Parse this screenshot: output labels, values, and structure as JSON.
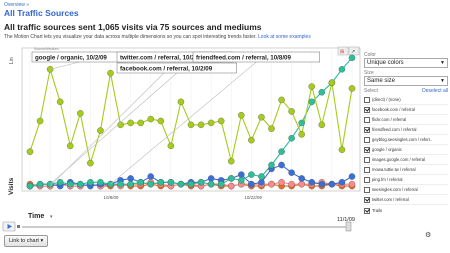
{
  "breadcrumb": "Overview »",
  "page_title": "All Traffic Sources",
  "headline": "All traffic sources sent 1,065 visits via 75 sources and mediums",
  "description": "The Motion Chart lets you visualize your data across multiple dimensions so you can spot interesting trends faster.",
  "description_link": "Look at some examples",
  "chart": {
    "source_label": "Source/Medium",
    "y_axis_label": "Visits",
    "y_scale": "Lin",
    "x_axis_label": "Time",
    "x_scale": "Lin",
    "date_shown": "11/1/09",
    "tooltips": [
      "google / organic, 10/2/09",
      "twitter.com / referral, 10/2/09",
      "friendfeed.com / referral, 10/8/09",
      "facebook.com / referral, 10/2/09"
    ],
    "x_tick_labels": [
      "10/8/09",
      "10/22/09"
    ]
  },
  "sidebar": {
    "color_label": "Color",
    "color_value": "Unique colors",
    "size_label": "Size",
    "size_value": "Same size",
    "select_label": "Select",
    "deselect_all": "Deselect all",
    "items": [
      {
        "label": "(direct) / (none)",
        "checked": false
      },
      {
        "label": "facebook.com / referral",
        "checked": true
      },
      {
        "label": "flickr.com / referral",
        "checked": false
      },
      {
        "label": "friendfeed.com / referral",
        "checked": true
      },
      {
        "label": "geyblog.seesingles.com / referr..",
        "checked": false
      },
      {
        "label": "google / organic",
        "checked": true
      },
      {
        "label": "images.google.com / referral",
        "checked": false
      },
      {
        "label": "mowa.tuttie.tw / referral",
        "checked": false
      },
      {
        "label": "ping.fm / referral",
        "checked": false
      },
      {
        "label": "seesingles.com / referral",
        "checked": false
      },
      {
        "label": "twitter.com / referral",
        "checked": true
      }
    ],
    "trails_label": "Trails",
    "trails_checked": true
  },
  "footer": {
    "link_button": "Link to chart ▾"
  },
  "colors": {
    "google": "#a6cc1a",
    "friendfeed": "#2bbf9a",
    "facebook": "#3a6fd8",
    "direct": "#ee6a1c",
    "twitter": "#ff8888",
    "accent_blue": "#3366cc"
  },
  "chart_data": {
    "type": "line",
    "x": [
      "9/30",
      "10/1",
      "10/2",
      "10/3",
      "10/4",
      "10/5",
      "10/6",
      "10/7",
      "10/8",
      "10/9",
      "10/10",
      "10/11",
      "10/12",
      "10/13",
      "10/14",
      "10/15",
      "10/16",
      "10/17",
      "10/18",
      "10/19",
      "10/20",
      "10/21",
      "10/22",
      "10/23",
      "10/24",
      "10/25",
      "10/26",
      "10/27",
      "10/28",
      "10/29",
      "10/30",
      "10/31",
      "11/1"
    ],
    "series": [
      {
        "name": "google / organic",
        "values": [
          19,
          35,
          62,
          45,
          22,
          39,
          13,
          30,
          60,
          33,
          34,
          34,
          36,
          35,
          22,
          45,
          33,
          33,
          34,
          35,
          14,
          38,
          25,
          37,
          31,
          46,
          40,
          28,
          53,
          33,
          55,
          20,
          52
        ]
      },
      {
        "name": "friendfeed.com / referral",
        "values": [
          1,
          2,
          2,
          3,
          2,
          2,
          3,
          3,
          2,
          2,
          2,
          3,
          2,
          3,
          3,
          2,
          2,
          3,
          2,
          2,
          5,
          4,
          7,
          6,
          12,
          19,
          26,
          34,
          45,
          50,
          55,
          62,
          68
        ]
      },
      {
        "name": "facebook.com / referral",
        "values": [
          1,
          2,
          2,
          1,
          3,
          2,
          1,
          2,
          2,
          4,
          5,
          3,
          6,
          3,
          3,
          2,
          3,
          3,
          5,
          4,
          5,
          7,
          2,
          3,
          10,
          12,
          8,
          5,
          3,
          2,
          2,
          3,
          6
        ]
      },
      {
        "name": "twitter.com / referral",
        "values": [
          1,
          1,
          1,
          2,
          1,
          1,
          2,
          1,
          2,
          1,
          2,
          2,
          3,
          2,
          1,
          2,
          2,
          1,
          2,
          2,
          1,
          2,
          2,
          2,
          2,
          3,
          2,
          2,
          2,
          3,
          2,
          2,
          2
        ]
      }
    ]
  }
}
